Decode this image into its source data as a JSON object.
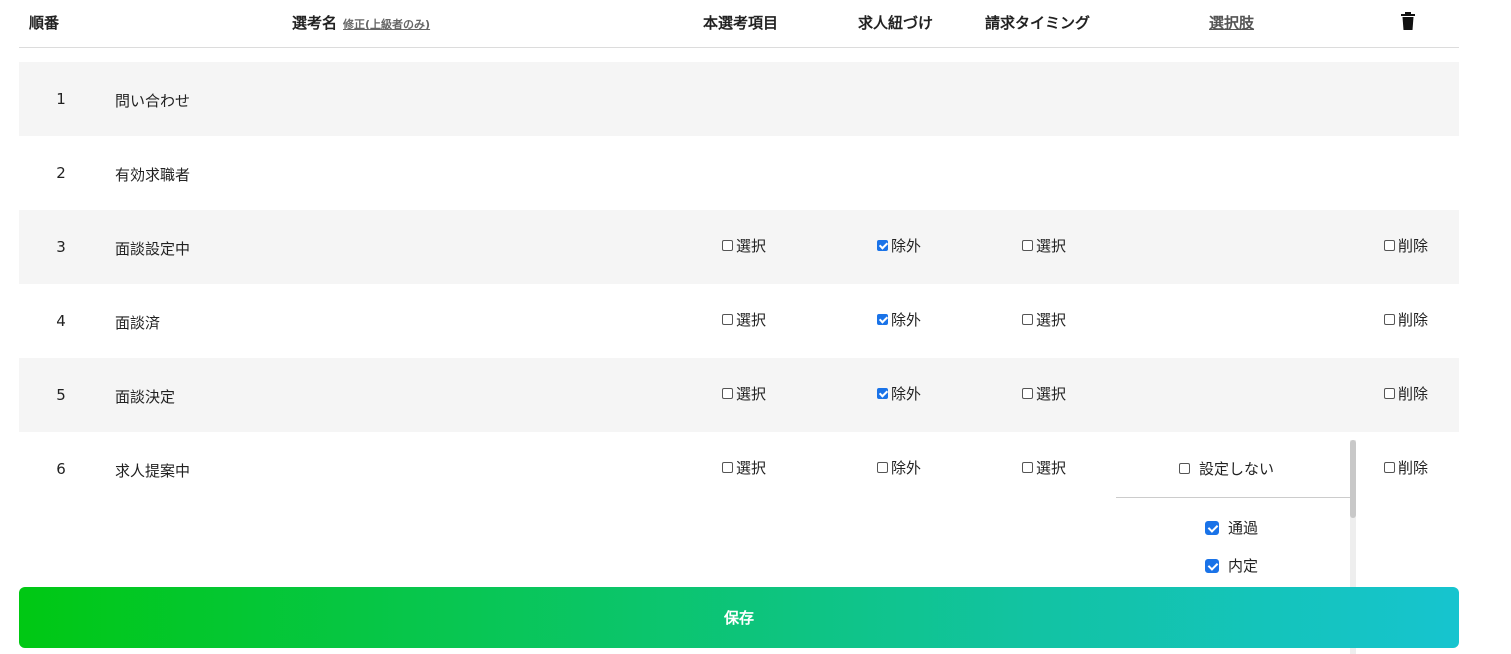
{
  "header": {
    "order": "順番",
    "name": "選考名",
    "edit_link": "修正(上級者のみ)",
    "main_item": "本選考項目",
    "job_link": "求人紐づけ",
    "billing": "請求タイミング",
    "options": "選択肢",
    "delete_icon": "trash-icon"
  },
  "rows": [
    {
      "num": "1",
      "name": "問い合わせ"
    },
    {
      "num": "2",
      "name": "有効求職者"
    },
    {
      "num": "3",
      "name": "面談設定中",
      "select": {
        "label": "選択",
        "checked": false
      },
      "exclude": {
        "label": "除外",
        "checked": true
      },
      "billing": {
        "label": "選択",
        "checked": false
      },
      "delete": {
        "label": "削除",
        "checked": false
      }
    },
    {
      "num": "4",
      "name": "面談済",
      "select": {
        "label": "選択",
        "checked": false
      },
      "exclude": {
        "label": "除外",
        "checked": true
      },
      "billing": {
        "label": "選択",
        "checked": false
      },
      "delete": {
        "label": "削除",
        "checked": false
      }
    },
    {
      "num": "5",
      "name": "面談決定",
      "select": {
        "label": "選択",
        "checked": false
      },
      "exclude": {
        "label": "除外",
        "checked": true
      },
      "billing": {
        "label": "選択",
        "checked": false
      },
      "delete": {
        "label": "削除",
        "checked": false
      }
    },
    {
      "num": "6",
      "name": "求人提案中",
      "select": {
        "label": "選択",
        "checked": false
      },
      "exclude": {
        "label": "除外",
        "checked": false
      },
      "billing": {
        "label": "選択",
        "checked": false
      },
      "delete": {
        "label": "削除",
        "checked": false
      }
    }
  ],
  "dropdown": {
    "none_option": {
      "label": "設定しない",
      "checked": false
    },
    "options": [
      {
        "label": "通過",
        "checked": true
      },
      {
        "label": "内定",
        "checked": true
      }
    ]
  },
  "save_label": "保存",
  "colors": {
    "accent_start": "#00c813",
    "accent_end": "#16c4cf",
    "check": "#1a73e8",
    "row_shade": "#f5f5f5"
  }
}
